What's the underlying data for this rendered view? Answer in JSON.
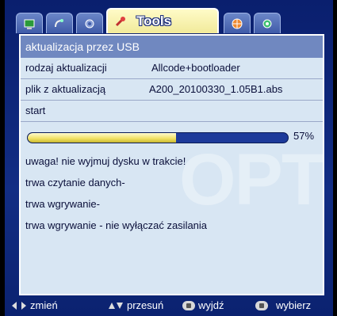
{
  "tabs": [
    {
      "icon": "tv-icon"
    },
    {
      "icon": "satellite-dish-icon"
    },
    {
      "icon": "wrench-gear-icon"
    },
    {
      "icon": "tools-icon",
      "label": "Tools",
      "active": true
    },
    {
      "icon": "globe-icon"
    },
    {
      "icon": "settings-icon"
    }
  ],
  "panel": {
    "title": "aktualizacja przez USB",
    "rows": [
      {
        "label": "rodzaj aktualizacji",
        "value": "Allcode+bootloader"
      },
      {
        "label": "plik z aktualizacją",
        "value": "A200_20100330_1.05B1.abs"
      },
      {
        "label": "start",
        "value": ""
      }
    ],
    "progress": {
      "percent": 57,
      "text": "57%"
    },
    "messages": [
      "uwaga! nie wyjmuj dysku w trakcie!",
      "trwa czytanie danych-",
      "trwa wgrywanie-",
      "trwa wgrywanie - nie wyłączać zasilania"
    ],
    "watermark": "OPTICUM"
  },
  "footer": [
    {
      "icon": "left-right-arrows-icon",
      "label": "zmień"
    },
    {
      "icon": "up-down-arrows-icon",
      "label": "przesuń"
    },
    {
      "icon": "exit-button-icon",
      "label": "wyjdź"
    },
    {
      "icon": "ok-button-icon",
      "label": "wybierz"
    }
  ]
}
